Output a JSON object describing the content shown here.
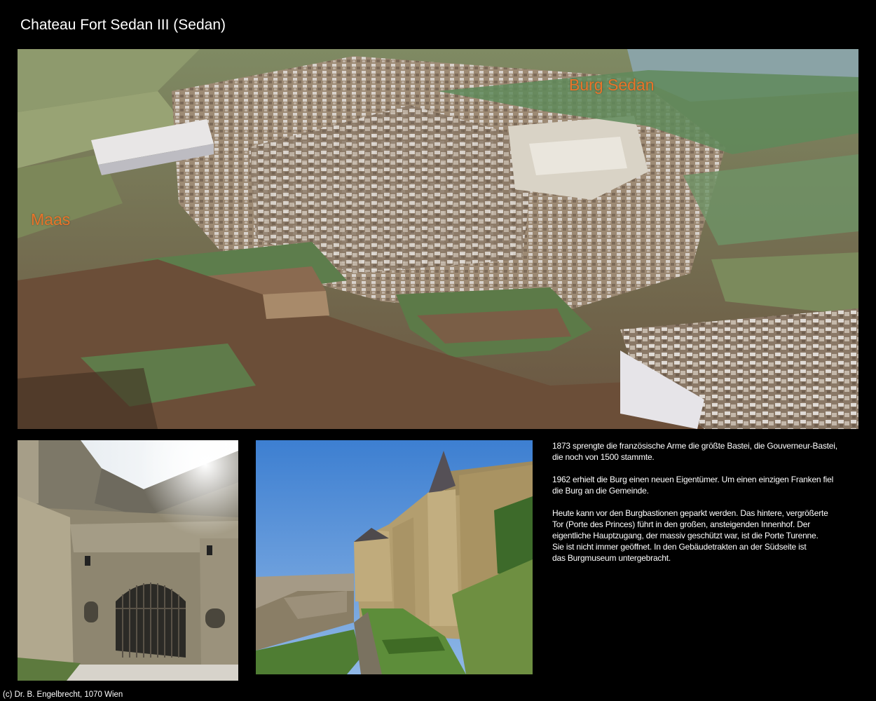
{
  "page": {
    "title": "Chateau Fort Sedan III (Sedan)",
    "footer": "(c) Dr. B. Engelbrecht, 1070 Wien"
  },
  "main_photo": {
    "labels": {
      "burg": "Burg Sedan",
      "maas": "Maas"
    },
    "label_color": "#e8742a"
  },
  "description": {
    "paragraphs": [
      "1873 sprengte die französische Arme die größte Bastei, die Gouverneur-Bastei,\ndie noch von 1500 stammte.",
      "1962 erhielt die Burg einen neuen Eigentümer. Um einen einzigen Franken fiel\ndie Burg an die Gemeinde.",
      "Heute kann vor den Burgbastionen geparkt werden. Das hintere, vergrößerte\nTor (Porte des Princes) führt in den großen, ansteigenden Innenhof. Der\neigentliche Hauptzugang, der massiv geschützt war, ist die Porte Turenne.\nSie ist nicht immer geöffnet. In den Gebäudetrakten an der Südseite ist\ndas Burgmuseum untergebracht."
    ]
  }
}
